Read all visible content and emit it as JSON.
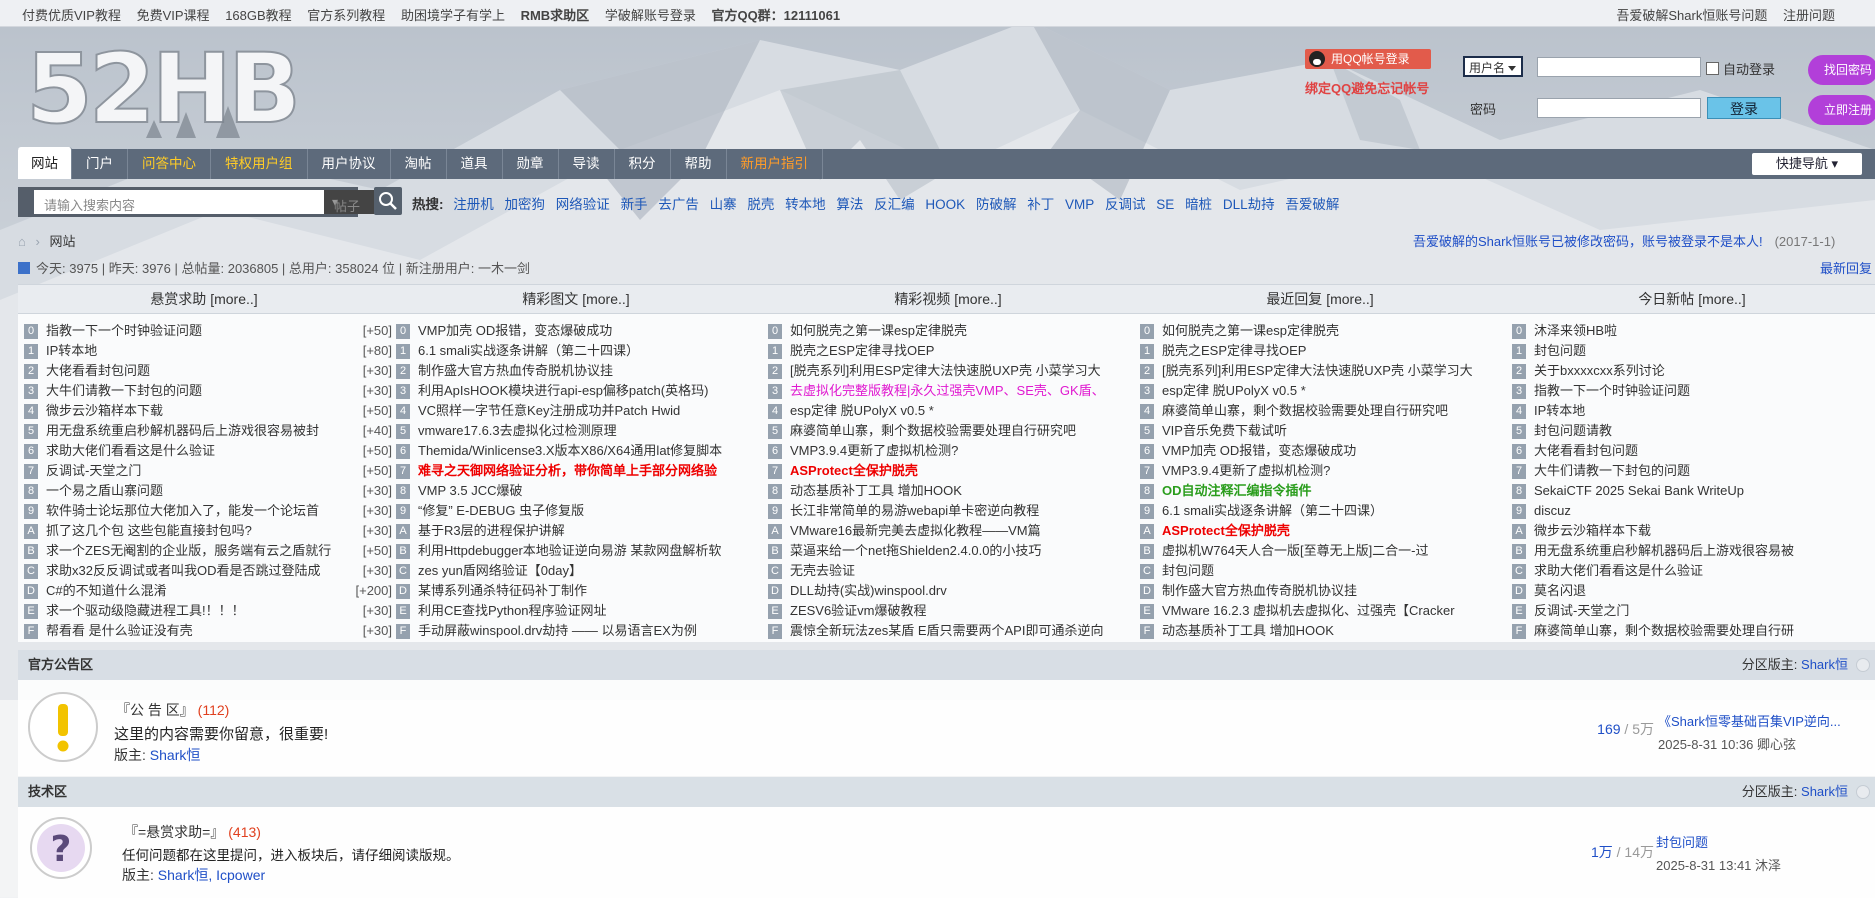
{
  "topbar": {
    "links": [
      {
        "label": "付费优质VIP教程",
        "style": "redn"
      },
      {
        "label": "免费VIP课程",
        "style": "blue"
      },
      {
        "label": "168GB教程",
        "style": ""
      },
      {
        "label": "官方系列教程",
        "style": ""
      },
      {
        "label": "助困境学子有学上",
        "style": ""
      },
      {
        "label": "RMB求助区",
        "style": "red"
      },
      {
        "label": "学破解账号登录",
        "style": ""
      },
      {
        "label": "官方QQ群：12111061",
        "style": "red"
      }
    ],
    "right_links": [
      "吾爱破解Shark恒账号问题",
      "注册问题"
    ]
  },
  "login": {
    "qq_button": "用QQ帐号登录",
    "qq_note": "绑定QQ避免忘记帐号",
    "username_select": "用户名",
    "auto_login": "自动登录",
    "password_label": "密码",
    "login_button": "登录",
    "recover_button": "找回密码",
    "register_button": "立即注册"
  },
  "logo_text": "52HB",
  "nav": {
    "items": [
      {
        "label": "网站",
        "style": "active"
      },
      {
        "label": "门户",
        "style": ""
      },
      {
        "label": "问答中心",
        "style": "y"
      },
      {
        "label": "特权用户组",
        "style": "y"
      },
      {
        "label": "用户协议",
        "style": ""
      },
      {
        "label": "淘帖",
        "style": ""
      },
      {
        "label": "道具",
        "style": ""
      },
      {
        "label": "勋章",
        "style": ""
      },
      {
        "label": "导读",
        "style": ""
      },
      {
        "label": "积分",
        "style": ""
      },
      {
        "label": "帮助",
        "style": ""
      },
      {
        "label": "新用户指引",
        "style": "o"
      }
    ],
    "quick_nav": "快捷导航"
  },
  "search": {
    "placeholder": "请输入搜索内容",
    "type": "帖子",
    "hot_label": "热搜:",
    "hot_words": [
      "注册机",
      "加密狗",
      "网络验证",
      "新手",
      "去广告",
      "山寨",
      "脱壳",
      "转本地",
      "算法",
      "反汇编",
      "HOOK",
      "防破解",
      "补丁",
      "VMP",
      "反调试",
      "SE",
      "暗桩",
      "DLL劫持",
      "吾爱破解"
    ]
  },
  "breadcrumb": "网站",
  "notice": {
    "text": "吾爱破解的Shark恒账号已被修改密码，账号被登录不是本人!",
    "date": "(2017-1-1)"
  },
  "stats": "今天: 3975  |  昨天: 3976  |  总帖量: 2036805  |  总用户: 358024 位  |  新注册用户: 一木一剑",
  "latest_reply": "最新回复",
  "columns": [
    {
      "title": "悬赏求助 [more..]",
      "rows": [
        {
          "i": "0",
          "t": "指教一下一个时钟验证问题",
          "c": "[+50]"
        },
        {
          "i": "1",
          "t": "IP转本地",
          "c": "[+80]"
        },
        {
          "i": "2",
          "t": "大佬看看封包问题",
          "c": "[+30]"
        },
        {
          "i": "3",
          "t": "大牛们请教一下封包的问题",
          "c": "[+30]"
        },
        {
          "i": "4",
          "t": "微步云沙箱样本下载",
          "c": "[+50]"
        },
        {
          "i": "5",
          "t": "用无盘系统重启秒解机器码后上游戏很容易被封",
          "c": "[+40]"
        },
        {
          "i": "6",
          "t": "求助大佬们看看这是什么验证",
          "c": "[+50]"
        },
        {
          "i": "7",
          "t": "反调试-天堂之门",
          "c": "[+50]"
        },
        {
          "i": "8",
          "t": "一个易之盾山寨问题",
          "c": "[+30]"
        },
        {
          "i": "9",
          "t": "软件骑士论坛那位大佬加入了，能发一个论坛首",
          "c": "[+30]"
        },
        {
          "i": "A",
          "t": "抓了这几个包 这些包能直接封包吗?",
          "c": "[+30]"
        },
        {
          "i": "B",
          "t": "求一个ZES无阉割的企业版，服务端有云之盾就行",
          "c": "[+50]"
        },
        {
          "i": "C",
          "t": "求助x32反反调试或者叫我OD看是否跳过登陆成",
          "c": "[+30]"
        },
        {
          "i": "D",
          "t": "C#的不知道什么混淆",
          "c": "[+200]"
        },
        {
          "i": "E",
          "t": "求一个驱动级隐藏进程工具!！！！",
          "c": "[+30]"
        },
        {
          "i": "F",
          "t": "帮看看 是什么验证没有壳",
          "c": "[+30]"
        }
      ]
    },
    {
      "title": "精彩图文 [more..]",
      "rows": [
        {
          "i": "0",
          "t": "VMP加壳 OD报错，变态爆破成功",
          "s": ""
        },
        {
          "i": "1",
          "t": "6.1 smali实战逐条讲解（第二十四课）",
          "s": ""
        },
        {
          "i": "2",
          "t": "制作盛大官方热血传奇脱机协议挂",
          "s": ""
        },
        {
          "i": "3",
          "t": "利用ApIsHOOK模块进行api-esp偏移patch(英格玛)",
          "s": ""
        },
        {
          "i": "4",
          "t": "VC照样一字节任意Key注册成功并Patch Hwid",
          "s": ""
        },
        {
          "i": "5",
          "t": "vmware17.6.3去虚拟化过检测原理",
          "s": ""
        },
        {
          "i": "6",
          "t": "Themida/Winlicense3.X版本X86/X64通用lat修复脚本",
          "s": ""
        },
        {
          "i": "7",
          "t": "难寻之天御网络验证分析，带你简单上手部分网络验",
          "s": "red2"
        },
        {
          "i": "8",
          "t": "VMP 3.5 JCC爆破",
          "s": "redn"
        },
        {
          "i": "9",
          "t": "“修复” E-DEBUG 虫子修复版",
          "s": ""
        },
        {
          "i": "A",
          "t": "基于R3层的进程保护讲解",
          "s": ""
        },
        {
          "i": "B",
          "t": "利用Httpdebugger本地验证逆向易游 某款网盘解析软",
          "s": ""
        },
        {
          "i": "C",
          "t": "zes yun盾网络验证【0day】",
          "s": ""
        },
        {
          "i": "D",
          "t": "某博系列通杀特征码补丁制作",
          "s": ""
        },
        {
          "i": "E",
          "t": "利用CE查找Python程序验证网址",
          "s": ""
        },
        {
          "i": "F",
          "t": "手动屏蔽winspool.drv劫持 —— 以易语言EX为例",
          "s": ""
        }
      ]
    },
    {
      "title": "精彩视频 [more..]",
      "rows": [
        {
          "i": "0",
          "t": "如何脱壳之第一课esp定律脱壳",
          "s": ""
        },
        {
          "i": "1",
          "t": "脱壳之ESP定律寻找OEP",
          "s": ""
        },
        {
          "i": "2",
          "t": "[脱壳系列]利用ESP定律大法快速脱UXP壳 小菜学习大",
          "s": ""
        },
        {
          "i": "3",
          "t": "去虚拟化完整版教程|永久过强壳VMP、SE壳、GK盾、",
          "s": "mag"
        },
        {
          "i": "4",
          "t": "esp定律 脱UPolyX v0.5 *",
          "s": ""
        },
        {
          "i": "5",
          "t": "麻婆简单山寨，剩个数据校验需要处理自行研究吧",
          "s": ""
        },
        {
          "i": "6",
          "t": "VMP3.9.4更新了虚拟机检测?",
          "s": ""
        },
        {
          "i": "7",
          "t": "ASProtect全保护脱壳",
          "s": "red2"
        },
        {
          "i": "8",
          "t": "动态基质补丁工具 增加HOOK",
          "s": ""
        },
        {
          "i": "9",
          "t": "长江非常简单的易游webapi单卡密逆向教程",
          "s": ""
        },
        {
          "i": "A",
          "t": "VMware16最新完美去虚拟化教程——VM篇",
          "s": ""
        },
        {
          "i": "B",
          "t": "菜逼来给一个net拖Shielden2.4.0.0的小技巧",
          "s": ""
        },
        {
          "i": "C",
          "t": "无壳去验证",
          "s": ""
        },
        {
          "i": "D",
          "t": "DLL劫持(实战)winspool.drv",
          "s": ""
        },
        {
          "i": "E",
          "t": "ZESV6验证vm爆破教程",
          "s": ""
        },
        {
          "i": "F",
          "t": "震惊全新玩法zes某盾 E盾只需要两个API即可通杀逆向",
          "s": ""
        }
      ]
    },
    {
      "title": "最近回复 [more..]",
      "rows": [
        {
          "i": "0",
          "t": "如何脱壳之第一课esp定律脱壳",
          "s": ""
        },
        {
          "i": "1",
          "t": "脱壳之ESP定律寻找OEP",
          "s": ""
        },
        {
          "i": "2",
          "t": "[脱壳系列]利用ESP定律大法快速脱UXP壳 小菜学习大",
          "s": ""
        },
        {
          "i": "3",
          "t": "esp定律 脱UPolyX v0.5 *",
          "s": ""
        },
        {
          "i": "4",
          "t": "麻婆简单山寨，剩个数据校验需要处理自行研究吧",
          "s": ""
        },
        {
          "i": "5",
          "t": "VIP音乐免费下载试听",
          "s": ""
        },
        {
          "i": "6",
          "t": "VMP加壳 OD报错，变态爆破成功",
          "s": ""
        },
        {
          "i": "7",
          "t": "VMP3.9.4更新了虚拟机检测?",
          "s": ""
        },
        {
          "i": "8",
          "t": "OD自动注释汇编指令插件",
          "s": "grn"
        },
        {
          "i": "9",
          "t": "6.1 smali实战逐条讲解（第二十四课）",
          "s": ""
        },
        {
          "i": "A",
          "t": "ASProtect全保护脱壳",
          "s": "red2"
        },
        {
          "i": "B",
          "t": "虚拟机W764天人合一版[至尊无上版]二合一-过",
          "s": ""
        },
        {
          "i": "C",
          "t": "封包问题",
          "s": ""
        },
        {
          "i": "D",
          "t": "制作盛大官方热血传奇脱机协议挂",
          "s": ""
        },
        {
          "i": "E",
          "t": "VMware 16.2.3 虚拟机去虚拟化、过强壳【Cracker",
          "s": ""
        },
        {
          "i": "F",
          "t": "动态基质补丁工具 增加HOOK",
          "s": ""
        }
      ]
    },
    {
      "title": "今日新帖 [more..]",
      "rows": [
        {
          "i": "0",
          "t": "沐泽来领HB啦",
          "s": ""
        },
        {
          "i": "1",
          "t": "封包问题",
          "s": ""
        },
        {
          "i": "2",
          "t": "关于bxxxxcxx系列讨论",
          "s": ""
        },
        {
          "i": "3",
          "t": "指教一下一个时钟验证问题",
          "s": ""
        },
        {
          "i": "4",
          "t": "IP转本地",
          "s": ""
        },
        {
          "i": "5",
          "t": "封包问题请教",
          "s": ""
        },
        {
          "i": "6",
          "t": "大佬看看封包问题",
          "s": ""
        },
        {
          "i": "7",
          "t": "大牛们请教一下封包的问题",
          "s": ""
        },
        {
          "i": "8",
          "t": "SekaiCTF 2025 Sekai Bank WriteUp",
          "s": ""
        },
        {
          "i": "9",
          "t": "discuz",
          "s": ""
        },
        {
          "i": "A",
          "t": "微步云沙箱样本下载",
          "s": ""
        },
        {
          "i": "B",
          "t": "用无盘系统重启秒解机器码后上游戏很容易被",
          "s": ""
        },
        {
          "i": "C",
          "t": "求助大佬们看看这是什么验证",
          "s": ""
        },
        {
          "i": "D",
          "t": "莫名闪退",
          "s": ""
        },
        {
          "i": "E",
          "t": "反调试-天堂之门",
          "s": ""
        },
        {
          "i": "F",
          "t": "麻婆简单山寨，剩个数据校验需要处理自行研",
          "s": ""
        }
      ]
    }
  ],
  "sections": [
    {
      "title": "官方公告区",
      "moderator_label": "分区版主:",
      "moderator": "Shark恒",
      "forum": {
        "name": "『公 告 区』",
        "count": "(112)",
        "desc": "这里的内容需要你留意，很重要!",
        "mod_label": "版主:",
        "mods": "Shark恒",
        "threads": "169",
        "posts": "5万",
        "last_title": "《Shark恒零基础百集VIP逆向...",
        "last_meta": "2025-8-31 10:36 卿心弦"
      }
    },
    {
      "title": "技术区",
      "moderator_label": "分区版主:",
      "moderator": "Shark恒",
      "forum": {
        "name": "『=悬赏求助=』",
        "count": "(413)",
        "desc": "任何问题都在这里提问，进入板块后，请仔细阅读版规。",
        "mod_label": "版主:",
        "mods": "Shark恒, Icpower",
        "threads": "1万",
        "posts": "14万",
        "last_title": "封包问题",
        "last_meta": "2025-8-31 13:41 沐泽"
      }
    }
  ]
}
